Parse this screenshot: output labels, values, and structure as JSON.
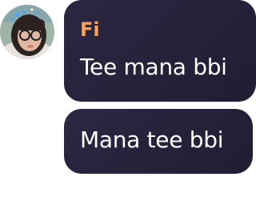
{
  "chat": {
    "sender": {
      "name": "Fi",
      "name_color": "#f4a261"
    },
    "messages": [
      {
        "text": "Tee mana bbi"
      },
      {
        "text": "Mana tee bbi"
      }
    ]
  },
  "colors": {
    "bubble": "#26213a",
    "bubble_text": "#ffffff",
    "background": "#ffffff"
  }
}
